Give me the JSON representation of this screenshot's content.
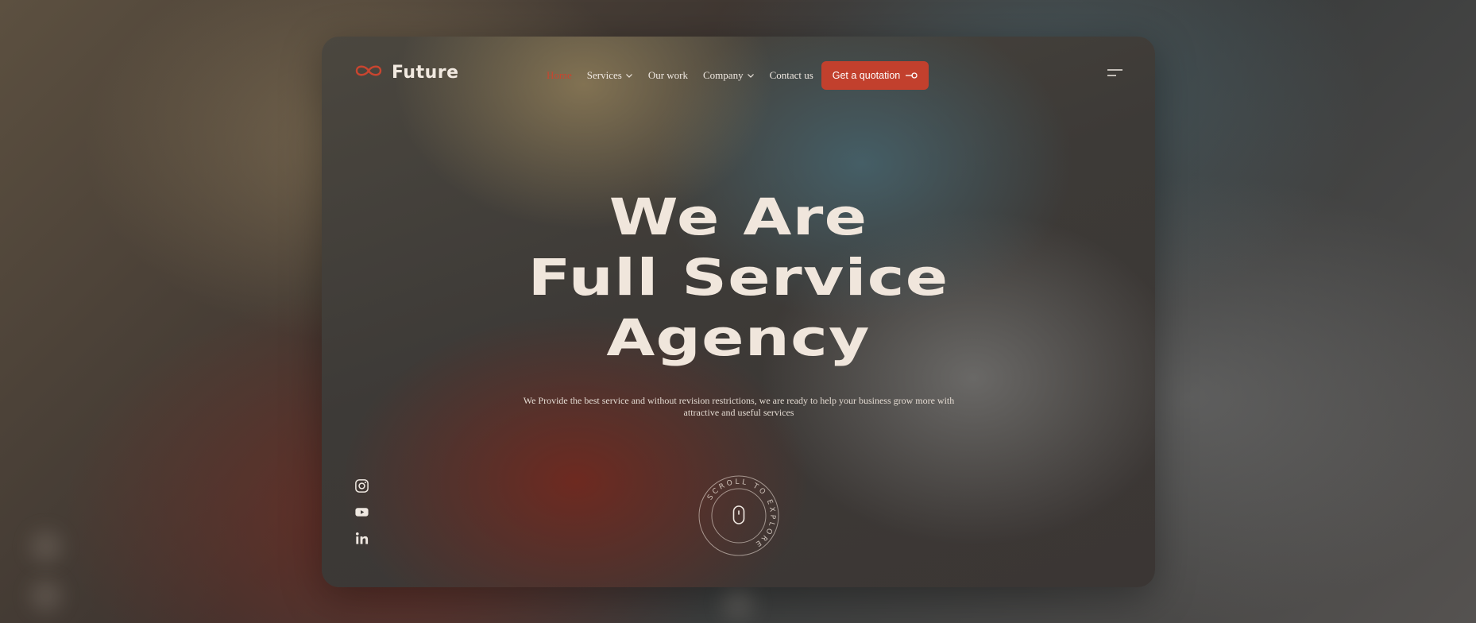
{
  "brand": {
    "name": "Future",
    "accent": "#c2402d",
    "logo_icon": "infinity-icon"
  },
  "nav": {
    "items": [
      {
        "label": "Home",
        "active": true,
        "dropdown": false
      },
      {
        "label": "Services",
        "active": false,
        "dropdown": true
      },
      {
        "label": "Our work",
        "active": false,
        "dropdown": false
      },
      {
        "label": "Company",
        "active": false,
        "dropdown": true
      },
      {
        "label": "Contact us",
        "active": false,
        "dropdown": false
      }
    ],
    "cta_label": "Get a quotation",
    "menu_icon": "hamburger-icon"
  },
  "hero": {
    "line1": "We Are",
    "line2": "Full Service",
    "line3": "Agency",
    "subtitle_line1": "We Provide the best service and without revision restrictions, we are ready to help your business grow more with",
    "subtitle_line2": "attractive and useful services"
  },
  "socials": [
    "instagram-icon",
    "youtube-icon",
    "linkedin-icon"
  ],
  "scroll": {
    "label": "SCROLL TO EXPLORE"
  }
}
